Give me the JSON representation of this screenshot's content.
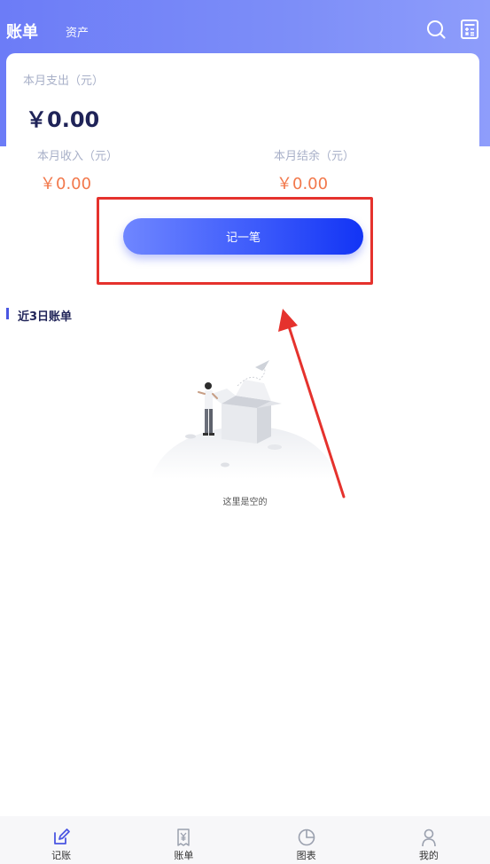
{
  "header": {
    "tab_bills": "账单",
    "tab_assets": "资产",
    "icons": [
      "search-icon",
      "calculator-icon"
    ]
  },
  "summary": {
    "expense_label": "本月支出（元）",
    "expense_value": "￥0.00",
    "income_label": "本月收入（元）",
    "income_value": "￥0.00",
    "balance_label": "本月结余（元）",
    "balance_value": "￥0.00"
  },
  "record_button_label": "记一笔",
  "recent": {
    "title": "近3日账单",
    "empty_text": "这里是空的"
  },
  "bottom_nav": {
    "items": [
      {
        "label": "记账",
        "icon": "edit-icon"
      },
      {
        "label": "账单",
        "icon": "bill-icon"
      },
      {
        "label": "图表",
        "icon": "pie-chart-icon"
      },
      {
        "label": "我的",
        "icon": "user-icon"
      }
    ]
  },
  "colors": {
    "header_gradient_start": "#6c7cf7",
    "header_gradient_end": "#8e9dfb",
    "button_gradient_start": "#6f86ff",
    "button_gradient_end": "#1234f5",
    "amount_orange": "#f2784b",
    "title_navy": "#1f2358",
    "annotation_red": "#e5322d"
  }
}
